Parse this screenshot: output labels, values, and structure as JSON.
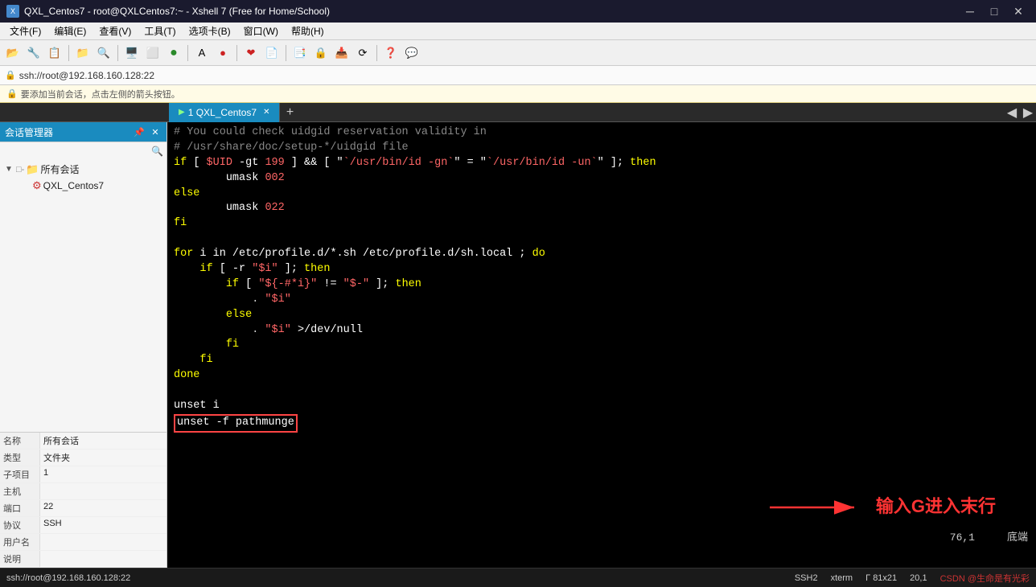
{
  "titlebar": {
    "title": "QXL_Centos7 - root@QXLCentos7:~ - Xshell 7 (Free for Home/School)",
    "icon": "X"
  },
  "menubar": {
    "items": [
      "文件(F)",
      "编辑(E)",
      "查看(V)",
      "工具(T)",
      "选项卡(B)",
      "窗口(W)",
      "帮助(H)"
    ]
  },
  "addressbar": {
    "text": "ssh://root@192.168.160.128:22"
  },
  "infobar": {
    "text": "要添加当前会话，点击左侧的箭头按钮。"
  },
  "sidebar": {
    "header": "会话管理器",
    "tree": {
      "root_label": "所有会话",
      "child_label": "QXL_Centos7"
    },
    "props": {
      "name_key": "名称",
      "name_val": "所有会话",
      "type_key": "类型",
      "type_val": "文件夹",
      "child_key": "子项目",
      "child_val": "1",
      "host_key": "主机",
      "host_val": "",
      "port_key": "端口",
      "port_val": "22",
      "protocol_key": "协议",
      "protocol_val": "SSH",
      "username_key": "用户名",
      "username_val": "",
      "desc_key": "说明",
      "desc_val": ""
    }
  },
  "tab": {
    "label": "1 QXL_Centos7",
    "icon": "▶"
  },
  "terminal": {
    "lines": [
      "# You could check uidgid reservation validity in",
      "# /usr/share/doc/setup-*/uidgid file",
      "if [ $UID -gt 199 ] && [ \"`/usr/bin/id -gn`\" = \"`/usr/bin/id -un`\" ]; then",
      "        umask 002",
      "else",
      "        umask 022",
      "fi",
      "",
      "for i in /etc/profile.d/*.sh /etc/profile.d/sh.local ; do",
      "    if [ -r \"$i\" ]; then",
      "        if [ \"${-#*i}\" != \"$-\" ]; then",
      "            . \"$i\"",
      "        else",
      "            . \"$i\" >/dev/null",
      "        fi",
      "    fi",
      "done",
      "",
      "unset i",
      "unset -f pathmunge"
    ]
  },
  "annotation": {
    "text": "输入G进入末行",
    "arrow": "→"
  },
  "vim_status": {
    "line": "76,1",
    "mode": "底端"
  },
  "statusbar": {
    "connection": "ssh://root@192.168.160.128:22",
    "protocol": "SSH2",
    "encoding": "xterm",
    "terminal_size": "Γ 81x21",
    "cursor_pos": "20,1",
    "watermark": "CSDN @生命是有光彩"
  }
}
